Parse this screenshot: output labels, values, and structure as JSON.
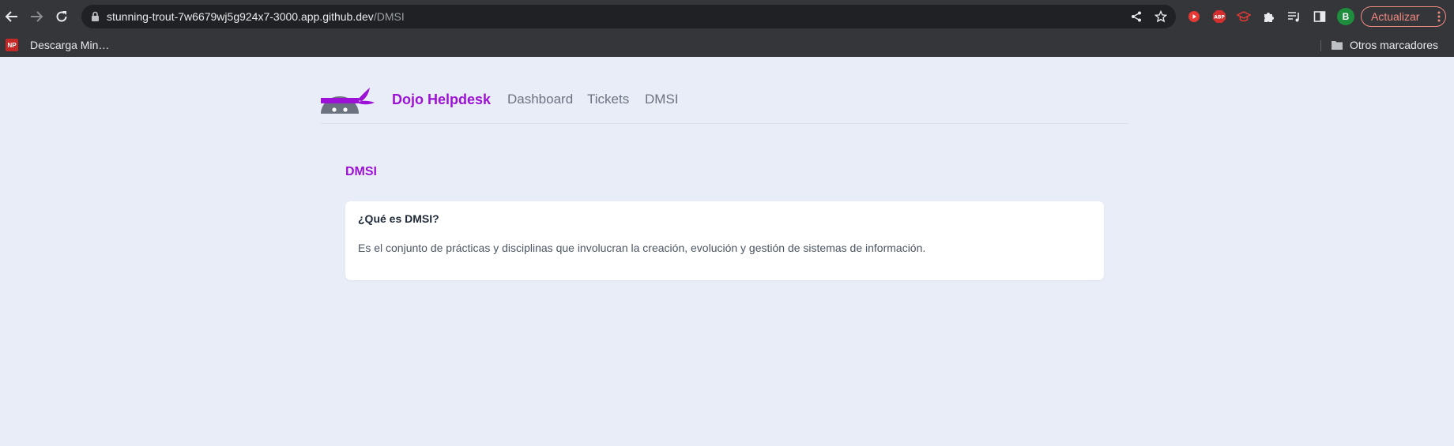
{
  "browser": {
    "url_host": "stunning-trout-7w6679wj5g924x7-3000.app.github.dev",
    "url_path": "/DMSI",
    "update_button_label": "Actualizar",
    "profile_initial": "B",
    "icons": {
      "back": "back-arrow-icon",
      "forward": "forward-arrow-icon",
      "reload": "reload-icon",
      "lock": "lock-icon",
      "share": "share-icon",
      "bookmark": "star-icon",
      "extensions": [
        "youtube-ext-icon",
        "adblock-plus-icon",
        "graduation-cap-ext-icon",
        "puzzle-icon",
        "reading-list-icon",
        "side-panel-icon"
      ],
      "menu": "kebab-menu-icon"
    },
    "accent_colors": {
      "chrome_dark": "#35363a",
      "omnibox": "#202124",
      "update": "#f28b82",
      "profile": "#1e8e3e"
    }
  },
  "bookmarks_bar": {
    "items": [
      {
        "favicon_text": "NP",
        "label": "Descarga Min…"
      }
    ],
    "other_bookmarks": "Otros marcadores"
  },
  "site": {
    "brand": "Dojo Helpdesk",
    "nav": [
      "Dashboard",
      "Tickets",
      "DMSI"
    ],
    "brand_color": "#9b12d6",
    "background_color": "#e9edf8"
  },
  "main": {
    "page_title": "DMSI",
    "card": {
      "title": "¿Qué es DMSI?",
      "text": "Es el conjunto de prácticas y disciplinas que involucran la creación, evolución y gestión de sistemas de información."
    }
  }
}
